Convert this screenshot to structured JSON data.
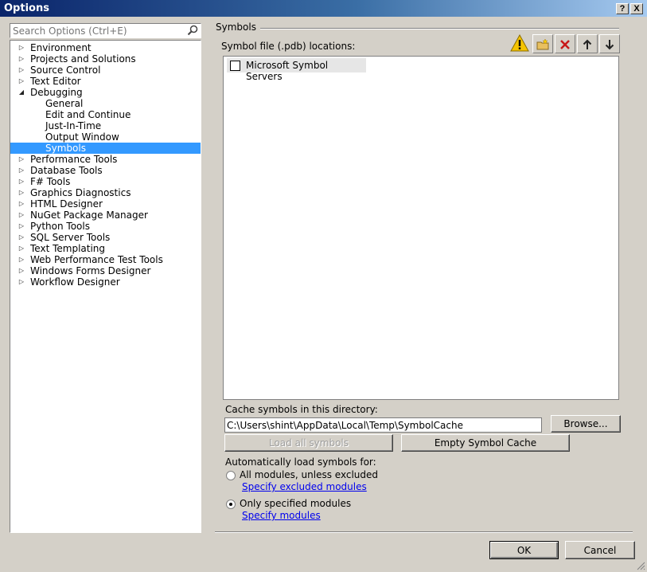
{
  "window": {
    "title": "Options",
    "help_label": "?",
    "close_label": "X"
  },
  "search": {
    "placeholder": "Search Options (Ctrl+E)"
  },
  "tree": [
    {
      "label": "Environment",
      "level": 0,
      "expanded": false
    },
    {
      "label": "Projects and Solutions",
      "level": 0,
      "expanded": false
    },
    {
      "label": "Source Control",
      "level": 0,
      "expanded": false
    },
    {
      "label": "Text Editor",
      "level": 0,
      "expanded": false
    },
    {
      "label": "Debugging",
      "level": 0,
      "expanded": true
    },
    {
      "label": "General",
      "level": 1
    },
    {
      "label": "Edit and Continue",
      "level": 1
    },
    {
      "label": "Just-In-Time",
      "level": 1
    },
    {
      "label": "Output Window",
      "level": 1
    },
    {
      "label": "Symbols",
      "level": 1,
      "selected": true
    },
    {
      "label": "Performance Tools",
      "level": 0,
      "expanded": false
    },
    {
      "label": "Database Tools",
      "level": 0,
      "expanded": false
    },
    {
      "label": "F# Tools",
      "level": 0,
      "expanded": false
    },
    {
      "label": "Graphics Diagnostics",
      "level": 0,
      "expanded": false
    },
    {
      "label": "HTML Designer",
      "level": 0,
      "expanded": false
    },
    {
      "label": "NuGet Package Manager",
      "level": 0,
      "expanded": false
    },
    {
      "label": "Python Tools",
      "level": 0,
      "expanded": false
    },
    {
      "label": "SQL Server Tools",
      "level": 0,
      "expanded": false
    },
    {
      "label": "Text Templating",
      "level": 0,
      "expanded": false
    },
    {
      "label": "Web Performance Test Tools",
      "level": 0,
      "expanded": false
    },
    {
      "label": "Windows Forms Designer",
      "level": 0,
      "expanded": false
    },
    {
      "label": "Workflow Designer",
      "level": 0,
      "expanded": false
    }
  ],
  "symbols": {
    "section_title": "Symbols",
    "locations_label": "Symbol file (.pdb) locations:",
    "toolbar_icons": [
      "warning-icon",
      "new-folder-icon",
      "delete-icon",
      "arrow-up-icon",
      "arrow-down-icon"
    ],
    "locations": [
      {
        "label": "Microsoft Symbol Servers",
        "checked": false
      }
    ],
    "cache_label": "Cache symbols in this directory:",
    "cache_path": "C:\\Users\\shint\\AppData\\Local\\Temp\\SymbolCache",
    "browse_label": "Browse...",
    "load_all_label": "Load all symbols",
    "empty_cache_label": "Empty Symbol Cache",
    "auto_label": "Automatically load symbols for:",
    "option_all": "All modules, unless excluded",
    "option_all_link": "Specify excluded modules",
    "option_only": "Only specified modules",
    "option_only_link": "Specify modules",
    "selected_option": "only"
  },
  "footer": {
    "ok_label": "OK",
    "cancel_label": "Cancel"
  }
}
